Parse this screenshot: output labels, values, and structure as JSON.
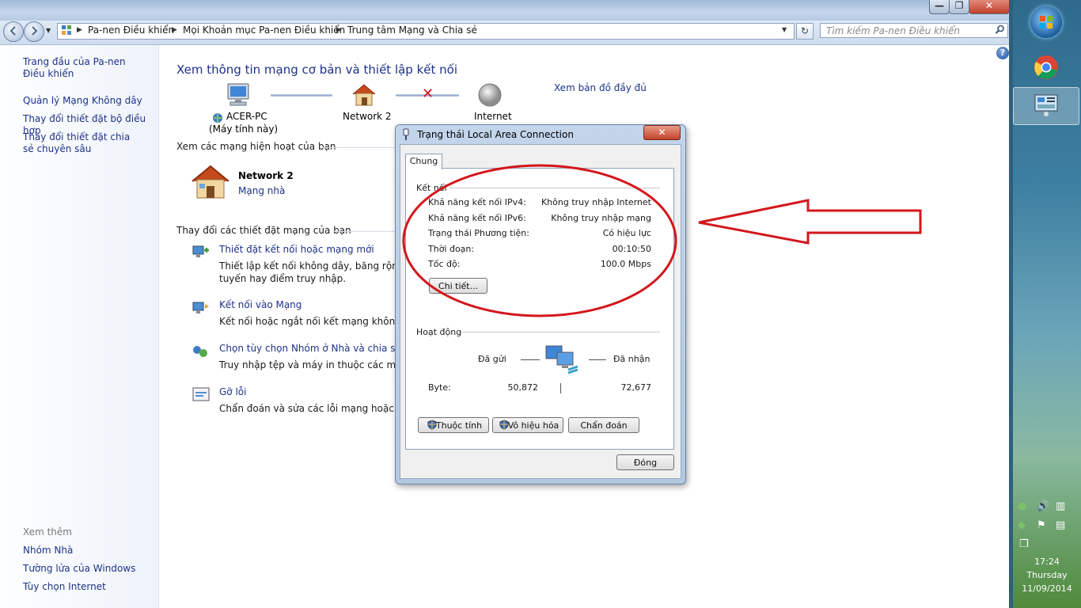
{
  "window": {
    "minimize_glyph": "—",
    "maximize_glyph": "❐",
    "close_glyph": "✕"
  },
  "address": {
    "crumbs": [
      "Pa-nen Điều khiển",
      "Mọi Khoản mục Pa-nen Điều khiển",
      "Trung tâm Mạng và Chia sẻ"
    ],
    "search_placeholder": "Tìm kiếm Pa-nen Điều khiển"
  },
  "sidebar": {
    "items": [
      "Trang đầu của Pa-nen Điều khiển",
      "Quản lý Mạng Không dây",
      "Thay đổi thiết đặt bộ điều hợp",
      "Thay đổi thiết đặt chia sẻ chuyên sâu"
    ],
    "see_also_label": "Xem thêm",
    "see_also": [
      "Nhóm Nhà",
      "Tường lửa của Windows",
      "Tùy chọn Internet"
    ]
  },
  "main": {
    "title": "Xem thông tin mạng cơ bản và thiết lập kết nối",
    "map_link": "Xem bản đồ đầy đủ",
    "computer_name": "ACER-PC",
    "computer_sub": "(Máy tính này)",
    "network_label": "Network  2",
    "internet_label": "Internet",
    "active_heading": "Xem các mạng hiện hoạt của bạn",
    "active_network_name": "Network  2",
    "active_network_type": "Mạng nhà",
    "change_heading": "Thay đổi các thiết đặt mạng của bạn",
    "tasks": [
      {
        "link": "Thiết đặt kết nối hoặc mạng mới",
        "desc": "Thiết lập kết nối không dây, băng rộng, qu",
        "desc2": "tuyến hay điểm truy nhập."
      },
      {
        "link": "Kết nối vào Mạng",
        "desc": "Kết nối hoặc ngắt nối kết mạng không dây",
        "desc2": ""
      },
      {
        "link": "Chọn tùy chọn Nhóm ở Nhà và chia sẻ",
        "desc": "Truy nhập tệp và máy in thuộc các máy tín",
        "desc2": ""
      },
      {
        "link": "Gỡ lỗi",
        "desc": "Chẩn đoán và sửa các lỗi mạng hoặc lấy th",
        "desc2": ""
      }
    ]
  },
  "dialog": {
    "title": "Trạng thái Local Area Connection",
    "close_glyph": "✕",
    "tab": "Chung",
    "connection_heading": "Kết nối",
    "rows": [
      {
        "label": "Khả năng kết nối IPv4:",
        "value": "Không truy nhập Internet"
      },
      {
        "label": "Khả năng kết nối IPv6:",
        "value": "Không truy nhập mạng"
      },
      {
        "label": "Trạng thái Phương tiện:",
        "value": "Có hiệu lực"
      },
      {
        "label": "Thời đoạn:",
        "value": "00:10:50"
      },
      {
        "label": "Tốc độ:",
        "value": "100.0 Mbps"
      }
    ],
    "details_button": "Chi tiết...",
    "activity_heading": "Hoạt động",
    "sent_label": "Đã gửi",
    "received_label": "Đã nhận",
    "bytes_label": "Byte:",
    "bytes_sent": "50,872",
    "bytes_received": "72,677",
    "properties_button": "Thuộc tính",
    "disable_button": "Vô hiệu hóa",
    "diagnose_button": "Chẩn đoán",
    "close_button": "Đóng"
  },
  "taskbar": {
    "time": "17:24",
    "day": "Thursday",
    "date": "11/09/2014"
  },
  "colors": {
    "link": "#1e3287",
    "annotation_red": "#d3161c"
  }
}
